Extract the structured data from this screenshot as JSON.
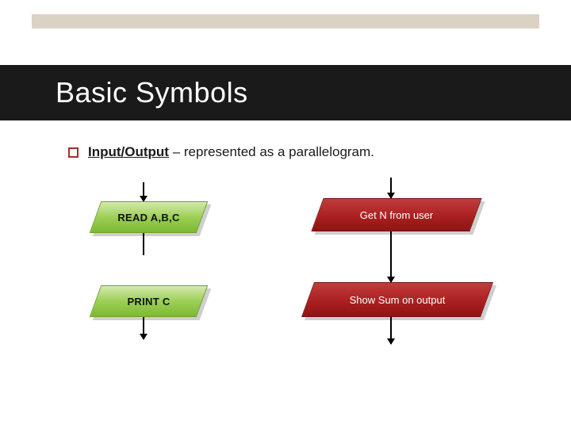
{
  "title": "Basic Symbols",
  "bullet": {
    "term": "Input/Output",
    "rest": " – represented as a parallelogram."
  },
  "shapes": {
    "read": "READ A,B,C",
    "print": "PRINT C",
    "getN": "Get N from user",
    "showSum": "Show Sum on output"
  }
}
